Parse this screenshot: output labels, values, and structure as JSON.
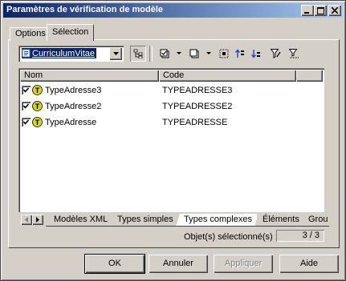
{
  "window": {
    "title": "Paramètres de vérification de modèle"
  },
  "tabs": [
    {
      "label": "Options"
    },
    {
      "label": "Sélection"
    }
  ],
  "toolbar": {
    "model_combo_value": "CurriculumVitae",
    "icons": [
      "hierarchy-icon",
      "select-all-icon",
      "deselect-icon",
      "select-all-tool-icon",
      "move-up-icon",
      "move-down-icon",
      "filter-icon",
      "filter-clear-icon"
    ]
  },
  "grid": {
    "columns": [
      {
        "label": "Nom"
      },
      {
        "label": "Code"
      }
    ],
    "rows": [
      {
        "name": "TypeAdresse3",
        "code": "TYPEADRESSE3",
        "checked": true
      },
      {
        "name": "TypeAdresse2",
        "code": "TYPEADRESSE2",
        "checked": true
      },
      {
        "name": "TypeAdresse",
        "code": "TYPEADRESSE",
        "checked": true
      }
    ]
  },
  "bottom_tabs": [
    {
      "label": "Modèles XML"
    },
    {
      "label": "Types simples"
    },
    {
      "label": "Types complexes"
    },
    {
      "label": "Éléments"
    },
    {
      "label": "Grou"
    }
  ],
  "status": {
    "label": "Objet(s) sélectionné(s) :",
    "value": "3 / 3"
  },
  "buttons": {
    "ok": "OK",
    "cancel": "Annuler",
    "apply": "Appliquer",
    "help": "Aide"
  },
  "colors": {
    "title_gradient_start": "#0a246a",
    "title_gradient_end": "#a6caf0",
    "face": "#d4d0c8",
    "selection": "#0a246a",
    "type_icon": "#d8d800"
  }
}
